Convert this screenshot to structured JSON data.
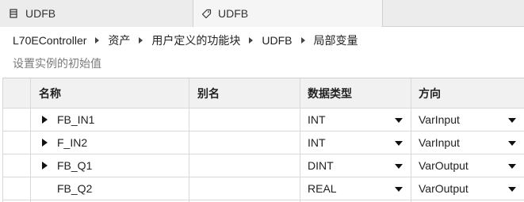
{
  "tabs": [
    {
      "label": "UDFB",
      "icon": "function-block-icon",
      "active": false
    },
    {
      "label": "UDFB",
      "icon": "tag-icon",
      "active": true
    }
  ],
  "breadcrumb": [
    "L70EController",
    "资产",
    "用户定义的功能块",
    "UDFB",
    "局部变量"
  ],
  "subtitle": "设置实例的初始值",
  "table": {
    "headers": [
      "名称",
      "别名",
      "数据类型",
      "方向"
    ],
    "rows": [
      {
        "name": "FB_IN1",
        "alias": "",
        "type": "INT",
        "direction": "VarInput",
        "expandable": true
      },
      {
        "name": "F_IN2",
        "alias": "",
        "type": "INT",
        "direction": "VarInput",
        "expandable": true
      },
      {
        "name": "FB_Q1",
        "alias": "",
        "type": "DINT",
        "direction": "VarOutput",
        "expandable": true
      },
      {
        "name": "FB_Q2",
        "alias": "",
        "type": "REAL",
        "direction": "VarOutput",
        "expandable": false
      }
    ]
  }
}
